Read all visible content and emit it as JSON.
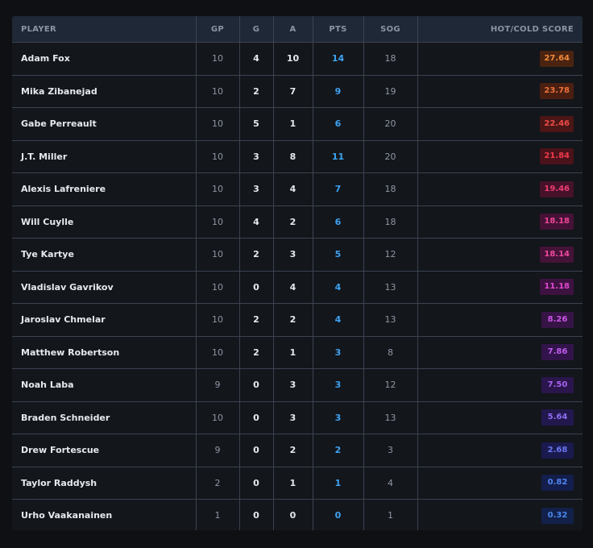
{
  "table": {
    "headers": {
      "player": "PLAYER",
      "gp": "GP",
      "g": "G",
      "a": "A",
      "pts": "PTS",
      "sog": "SOG",
      "hot": "HOT/COLD SCORE"
    },
    "rows": [
      {
        "player": "Adam Fox",
        "gp": "10",
        "g": "4",
        "a": "10",
        "pts": "14",
        "sog": "18",
        "score": "27.64",
        "score_bg": "#4a2410",
        "score_fg": "#f08a3c"
      },
      {
        "player": "Mika Zibanejad",
        "gp": "10",
        "g": "2",
        "a": "7",
        "pts": "9",
        "sog": "19",
        "score": "23.78",
        "score_bg": "#4a1f12",
        "score_fg": "#ec7038"
      },
      {
        "player": "Gabe Perreault",
        "gp": "10",
        "g": "5",
        "a": "1",
        "pts": "6",
        "sog": "20",
        "score": "22.46",
        "score_bg": "#4a1616",
        "score_fg": "#ec4c45"
      },
      {
        "player": "J.T. Miller",
        "gp": "10",
        "g": "3",
        "a": "8",
        "pts": "11",
        "sog": "20",
        "score": "21.84",
        "score_bg": "#4a121a",
        "score_fg": "#ee3a4a"
      },
      {
        "player": "Alexis Lafreniere",
        "gp": "10",
        "g": "3",
        "a": "4",
        "pts": "7",
        "sog": "18",
        "score": "19.46",
        "score_bg": "#45122a",
        "score_fg": "#ee3e72"
      },
      {
        "player": "Will Cuylle",
        "gp": "10",
        "g": "4",
        "a": "2",
        "pts": "6",
        "sog": "18",
        "score": "18.18",
        "score_bg": "#451236",
        "score_fg": "#ec4596"
      },
      {
        "player": "Tye Kartye",
        "gp": "10",
        "g": "2",
        "a": "3",
        "pts": "5",
        "sog": "12",
        "score": "18.14",
        "score_bg": "#451238",
        "score_fg": "#ec4a9e"
      },
      {
        "player": "Vladislav Gavrikov",
        "gp": "10",
        "g": "0",
        "a": "4",
        "pts": "4",
        "sog": "13",
        "score": "11.18",
        "score_bg": "#3e1240",
        "score_fg": "#de4ad0"
      },
      {
        "player": "Jaroslav Chmelar",
        "gp": "10",
        "g": "2",
        "a": "2",
        "pts": "4",
        "sog": "13",
        "score": "8.26",
        "score_bg": "#361446",
        "score_fg": "#cc55e8"
      },
      {
        "player": "Matthew Robertson",
        "gp": "10",
        "g": "2",
        "a": "1",
        "pts": "3",
        "sog": "8",
        "score": "7.86",
        "score_bg": "#32144a",
        "score_fg": "#c05cee"
      },
      {
        "player": "Noah Laba",
        "gp": "9",
        "g": "0",
        "a": "3",
        "pts": "3",
        "sog": "12",
        "score": "7.50",
        "score_bg": "#2a164c",
        "score_fg": "#a862f0"
      },
      {
        "player": "Braden Schneider",
        "gp": "10",
        "g": "0",
        "a": "3",
        "pts": "3",
        "sog": "13",
        "score": "5.64",
        "score_bg": "#22184e",
        "score_fg": "#8e6cf2"
      },
      {
        "player": "Drew Fortescue",
        "gp": "9",
        "g": "0",
        "a": "2",
        "pts": "2",
        "sog": "3",
        "score": "2.68",
        "score_bg": "#1a1a4e",
        "score_fg": "#6a78f0"
      },
      {
        "player": "Taylor Raddysh",
        "gp": "2",
        "g": "0",
        "a": "1",
        "pts": "1",
        "sog": "4",
        "score": "0.82",
        "score_bg": "#141e4c",
        "score_fg": "#4f84f0"
      },
      {
        "player": "Urho Vaakanainen",
        "gp": "1",
        "g": "0",
        "a": "0",
        "pts": "0",
        "sog": "1",
        "score": "0.32",
        "score_bg": "#12204a",
        "score_fg": "#4a88ee"
      }
    ]
  }
}
